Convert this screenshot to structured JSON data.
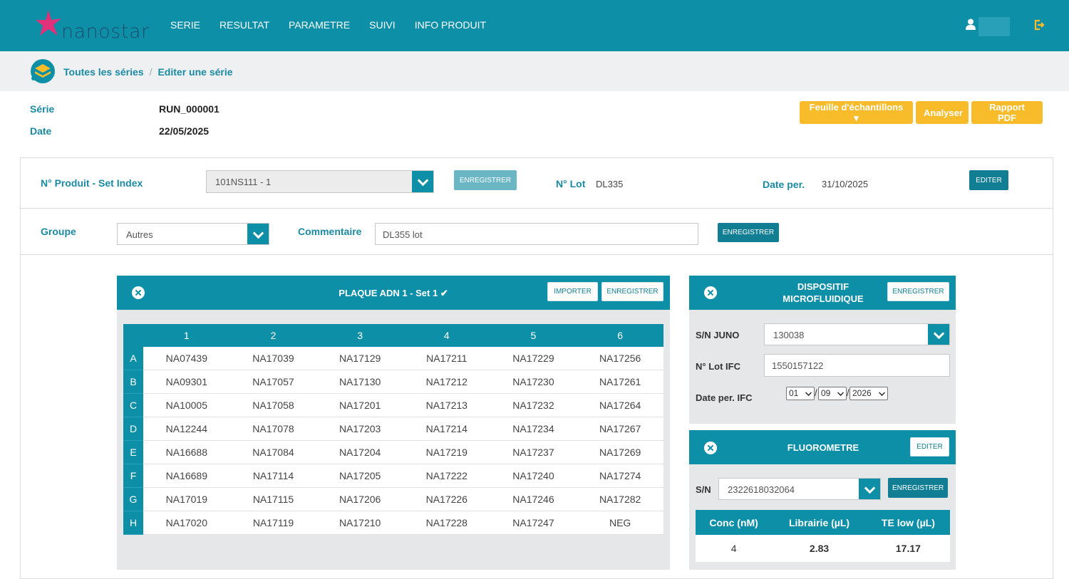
{
  "brand": {
    "name": "nanostar"
  },
  "nav": {
    "items": [
      "SERIE",
      "RESULTAT",
      "PARAMETRE",
      "SUIVI",
      "INFO PRODUIT"
    ]
  },
  "breadcrumb": {
    "root": "Toutes les séries",
    "sep": "/",
    "current": "Editer une série"
  },
  "series": {
    "serie_label": "Série",
    "serie_value": "RUN_000001",
    "date_label": "Date",
    "date_value": "22/05/2025"
  },
  "actions": {
    "sample_sheet": "Feuille d'échantillons ▾",
    "analyze": "Analyser",
    "pdf": "Rapport PDF"
  },
  "product": {
    "label": "N° Produit - Set Index",
    "value": "101NS111 - 1",
    "save": "ENREGISTRER",
    "lot_label": "N° Lot",
    "lot_value": "DL335",
    "date_label": "Date per.",
    "date_value": "31/10/2025",
    "edit": "EDITER"
  },
  "group": {
    "label": "Groupe",
    "value": "Autres",
    "comment_label": "Commentaire",
    "comment_value": "DL355 lot",
    "save": "ENREGISTRER"
  },
  "plate": {
    "title": "PLAQUE ADN 1 - Set 1 ✔",
    "import": "IMPORTER",
    "save": "ENREGISTRER",
    "columns": [
      "1",
      "2",
      "3",
      "4",
      "5",
      "6"
    ],
    "rows": [
      {
        "label": "A",
        "cells": [
          "NA07439",
          "NA17039",
          "NA17129",
          "NA17211",
          "NA17229",
          "NA17256"
        ]
      },
      {
        "label": "B",
        "cells": [
          "NA09301",
          "NA17057",
          "NA17130",
          "NA17212",
          "NA17230",
          "NA17261"
        ]
      },
      {
        "label": "C",
        "cells": [
          "NA10005",
          "NA17058",
          "NA17201",
          "NA17213",
          "NA17232",
          "NA17264"
        ]
      },
      {
        "label": "D",
        "cells": [
          "NA12244",
          "NA17078",
          "NA17203",
          "NA17214",
          "NA17234",
          "NA17267"
        ]
      },
      {
        "label": "E",
        "cells": [
          "NA16688",
          "NA17084",
          "NA17204",
          "NA17219",
          "NA17237",
          "NA17269"
        ]
      },
      {
        "label": "F",
        "cells": [
          "NA16689",
          "NA17114",
          "NA17205",
          "NA17222",
          "NA17240",
          "NA17274"
        ]
      },
      {
        "label": "G",
        "cells": [
          "NA17019",
          "NA17115",
          "NA17206",
          "NA17226",
          "NA17246",
          "NA17282"
        ]
      },
      {
        "label": "H",
        "cells": [
          "NA17020",
          "NA17119",
          "NA17210",
          "NA17228",
          "NA17247",
          "NEG"
        ]
      }
    ]
  },
  "device": {
    "title_line1": "DISPOSITIF",
    "title_line2": "MICROFLUIDIQUE",
    "save": "ENREGISTRER",
    "sn_label": "S/N JUNO",
    "sn_value": "130038",
    "lot_label": "N° Lot IFC",
    "lot_value": "1550157122",
    "date_label": "Date per. IFC",
    "day": "01",
    "month": "09",
    "year": "2026",
    "sep": "/"
  },
  "fluoro": {
    "title": "FLUOROMETRE",
    "edit": "EDITER",
    "sn_label": "S/N",
    "sn_value": "2322618032064",
    "save": "ENREGISTRER",
    "headers": [
      "Conc (nM)",
      "Librairie (µL)",
      "TE low (µL)"
    ],
    "values": [
      "4",
      "2.83",
      "17.17"
    ]
  },
  "colors": {
    "primary": "#0e8fa8",
    "accent": "#f8bc2a",
    "brand_pink": "#e0317a"
  }
}
